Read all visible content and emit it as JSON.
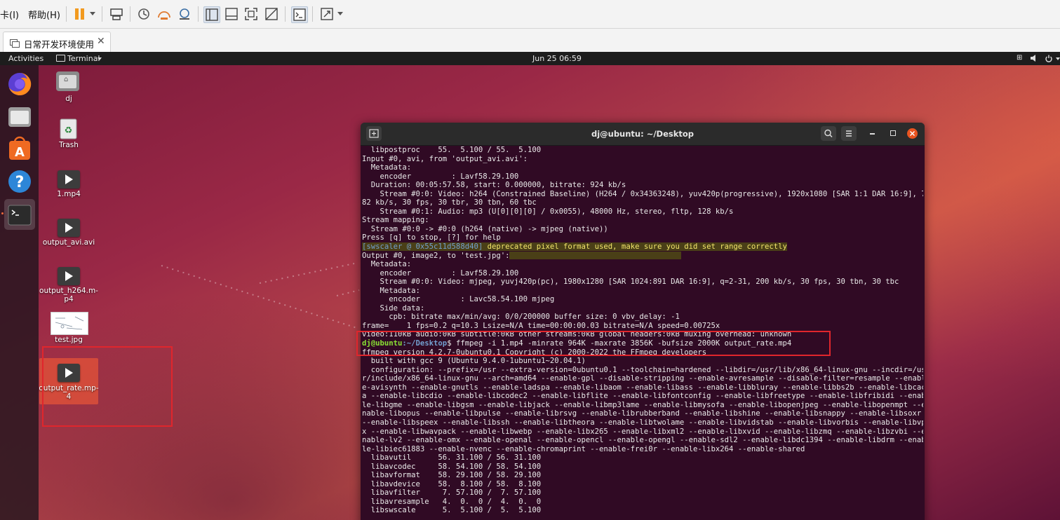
{
  "vmware": {
    "menus": [
      "卡(I)",
      "帮助(H)"
    ],
    "tab_label": "日常开发环境使用"
  },
  "gnome": {
    "activities": "Activities",
    "app_menu": "Terminal",
    "clock": "Jun 25  06:59"
  },
  "dock": {
    "apps": [
      "firefox-icon",
      "files-icon",
      "ubuntu-software-icon",
      "help-icon",
      "terminal-icon"
    ]
  },
  "desktop": {
    "icons": [
      {
        "label": "dj",
        "type": "home-folder-icon"
      },
      {
        "label": "Trash",
        "type": "trash-icon"
      },
      {
        "label": "1.mp4",
        "type": "video-file-icon"
      },
      {
        "label": "output_avi.avi",
        "type": "video-file-icon"
      },
      {
        "label": "output_h264.m-\np4",
        "type": "video-file-icon"
      },
      {
        "label": "test.jpg",
        "type": "image-file-icon"
      },
      {
        "label": "output_rate.mp-\n4",
        "type": "video-file-icon",
        "selected": true
      }
    ]
  },
  "terminal": {
    "title": "dj@ubuntu: ~/Desktop",
    "prompt_user": "dj@ubuntu",
    "prompt_path": ":~/Desktop",
    "lines": [
      "  libpostproc    55.  5.100 / 55.  5.100",
      "Input #0, avi, from 'output_avi.avi':",
      "  Metadata:",
      "    encoder         : Lavf58.29.100",
      "  Duration: 00:05:57.58, start: 0.000000, bitrate: 924 kb/s",
      "    Stream #0:0: Video: h264 (Constrained Baseline) (H264 / 0x34363248), yuv420p(progressive), 1920x1080 [SAR 1:1 DAR 16:9], 7",
      "82 kb/s, 30 fps, 30 tbr, 30 tbn, 60 tbc",
      "    Stream #0:1: Audio: mp3 (U[0][0][0] / 0x0055), 48000 Hz, stereo, fltp, 128 kb/s",
      "Stream mapping:",
      "  Stream #0:0 -> #0:0 (h264 (native) -> mjpeg (native))",
      "Press [q] to stop, [?] for help",
      "[swscaler @ 0x55c11d588d40] deprecated pixel format used, make sure you did set range correctly",
      "Output #0, image2, to 'test.jpg':",
      "  Metadata:",
      "    encoder         : Lavf58.29.100",
      "    Stream #0:0: Video: mjpeg, yuvj420p(pc), 1980x1280 [SAR 1024:891 DAR 16:9], q=2-31, 200 kb/s, 30 fps, 30 tbn, 30 tbc",
      "    Metadata:",
      "      encoder         : Lavc58.54.100 mjpeg",
      "    Side data:",
      "      cpb: bitrate max/min/avg: 0/0/200000 buffer size: 0 vbv_delay: -1",
      "frame=    1 fps=0.2 q=10.3 Lsize=N/A time=00:00:00.03 bitrate=N/A speed=0.00725x",
      "video:110kB audio:0kB subtitle:0kB other streams:0kB global headers:0kB muxing overhead: unknown",
      "$ ffmpeg -i 1.mp4 -minrate 964K -maxrate 3856K -bufsize 2000K output_rate.mp4",
      "ffmpeg version 4.2.7-0ubuntu0.1 Copyright (c) 2000-2022 the FFmpeg developers",
      "  built with gcc 9 (Ubuntu 9.4.0-1ubuntu1~20.04.1)",
      "  configuration: --prefix=/usr --extra-version=0ubuntu0.1 --toolchain=hardened --libdir=/usr/lib/x86_64-linux-gnu --incdir=/us",
      "r/include/x86_64-linux-gnu --arch=amd64 --enable-gpl --disable-stripping --enable-avresample --disable-filter=resample --enabl",
      "e-avisynth --enable-gnutls --enable-ladspa --enable-libaom --enable-libass --enable-libbluray --enable-libbs2b --enable-libcac",
      "a --enable-libcdio --enable-libcodec2 --enable-libflite --enable-libfontconfig --enable-libfreetype --enable-libfribidi --enab",
      "le-libgme --enable-libgsm --enable-libjack --enable-libmp3lame --enable-libmysofa --enable-libopenjpeg --enable-libopenmpt --e",
      "nable-libopus --enable-libpulse --enable-librsvg --enable-librubberband --enable-libshine --enable-libsnappy --enable-libsoxr",
      "--enable-libspeex --enable-libssh --enable-libtheora --enable-libtwolame --enable-libvidstab --enable-libvorbis --enable-libvp",
      "x --enable-libwavpack --enable-libwebp --enable-libx265 --enable-libxml2 --enable-libxvid --enable-libzmq --enable-libzvbi --e",
      "nable-lv2 --enable-omx --enable-openal --enable-opencl --enable-opengl --enable-sdl2 --enable-libdc1394 --enable-libdrm --enab",
      "le-libiec61883 --enable-nvenc --enable-chromaprint --enable-frei0r --enable-libx264 --enable-shared",
      "  libavutil      56. 31.100 / 56. 31.100",
      "  libavcodec     58. 54.100 / 58. 54.100",
      "  libavformat    58. 29.100 / 58. 29.100",
      "  libavdevice    58.  8.100 / 58.  8.100",
      "  libavfilter     7. 57.100 /  7. 57.100",
      "  libavresample   4.  0.  0 /  4.  0.  0",
      "  libswscale      5.  5.100 /  5.  5.100"
    ],
    "swscaler_tag": "[swscaler @ 0x55c11d588d40]"
  }
}
